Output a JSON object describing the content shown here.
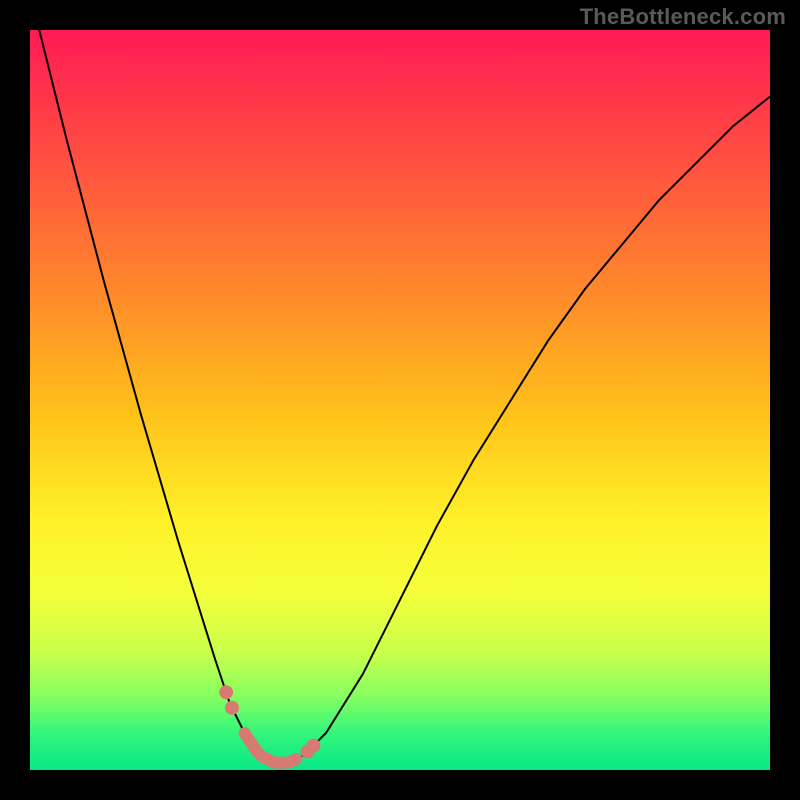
{
  "watermark": "TheBottleneck.com",
  "colors": {
    "frame": "#000000",
    "curve": "#000000",
    "band": "#d77a72"
  },
  "chart_data": {
    "type": "line",
    "title": "",
    "xlabel": "",
    "ylabel": "",
    "xlim": [
      0,
      100
    ],
    "ylim": [
      0,
      100
    ],
    "grid": false,
    "legend": false,
    "series": [
      {
        "name": "bottleneck-curve",
        "x": [
          0,
          5,
          10,
          15,
          20,
          25,
          27,
          29,
          31,
          33,
          35,
          37,
          40,
          45,
          50,
          55,
          60,
          65,
          70,
          75,
          80,
          85,
          90,
          95,
          100
        ],
        "y": [
          105,
          85,
          66,
          48,
          31,
          15,
          9,
          5,
          2,
          1,
          1,
          2,
          5,
          13,
          23,
          33,
          42,
          50,
          58,
          65,
          71,
          77,
          82,
          87,
          91
        ]
      }
    ],
    "band": {
      "description": "Highlighted near-zero bottleneck region along the curve",
      "x_range": [
        26,
        40
      ],
      "dots_x": [
        26.5,
        27.3,
        37.5,
        38.3
      ],
      "segment_x": [
        29,
        36
      ]
    },
    "background_gradient": {
      "orientation": "vertical",
      "stops": [
        {
          "pos": 0.0,
          "color": "#ff1a54"
        },
        {
          "pos": 0.18,
          "color": "#ff5140"
        },
        {
          "pos": 0.36,
          "color": "#ff8b2a"
        },
        {
          "pos": 0.52,
          "color": "#ffc21a"
        },
        {
          "pos": 0.66,
          "color": "#fff028"
        },
        {
          "pos": 0.76,
          "color": "#f4ff3a"
        },
        {
          "pos": 0.84,
          "color": "#c9ff4a"
        },
        {
          "pos": 0.9,
          "color": "#86ff60"
        },
        {
          "pos": 0.95,
          "color": "#34f57a"
        },
        {
          "pos": 1.0,
          "color": "#07e888"
        }
      ]
    }
  }
}
